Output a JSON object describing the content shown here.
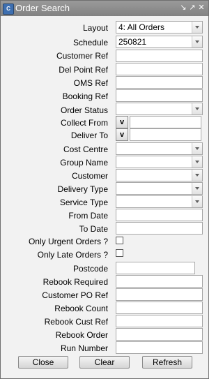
{
  "window": {
    "title": "Order Search",
    "app_icon": "C"
  },
  "fields": {
    "layout": {
      "label": "Layout",
      "value": "4: All Orders"
    },
    "schedule": {
      "label": "Schedule",
      "value": "250821"
    },
    "customer_ref": {
      "label": "Customer Ref",
      "value": ""
    },
    "del_point_ref": {
      "label": "Del Point Ref",
      "value": ""
    },
    "oms_ref": {
      "label": "OMS Ref",
      "value": ""
    },
    "booking_ref": {
      "label": "Booking Ref",
      "value": ""
    },
    "order_status": {
      "label": "Order Status",
      "value": ""
    },
    "collect_from": {
      "label": "Collect From",
      "button": "v",
      "value": ""
    },
    "deliver_to": {
      "label": "Deliver To",
      "button": "v",
      "value": ""
    },
    "cost_centre": {
      "label": "Cost Centre",
      "value": ""
    },
    "group_name": {
      "label": "Group Name",
      "value": ""
    },
    "customer": {
      "label": "Customer",
      "value": ""
    },
    "delivery_type": {
      "label": "Delivery Type",
      "value": ""
    },
    "service_type": {
      "label": "Service Type",
      "value": ""
    },
    "from_date": {
      "label": "From Date",
      "value": ""
    },
    "to_date": {
      "label": "To Date",
      "value": ""
    },
    "only_urgent": {
      "label": "Only Urgent Orders ?",
      "checked": false
    },
    "only_late": {
      "label": "Only Late Orders ?",
      "checked": false
    },
    "postcode": {
      "label": "Postcode",
      "value": ""
    },
    "rebook_required": {
      "label": "Rebook Required",
      "value": ""
    },
    "customer_po_ref": {
      "label": "Customer PO Ref",
      "value": ""
    },
    "rebook_count": {
      "label": "Rebook Count",
      "value": ""
    },
    "rebook_cust_ref": {
      "label": "Rebook Cust Ref",
      "value": ""
    },
    "rebook_order": {
      "label": "Rebook Order",
      "value": ""
    },
    "run_number": {
      "label": "Run Number",
      "value": ""
    }
  },
  "buttons": {
    "close": "Close",
    "clear": "Clear",
    "refresh": "Refresh"
  }
}
